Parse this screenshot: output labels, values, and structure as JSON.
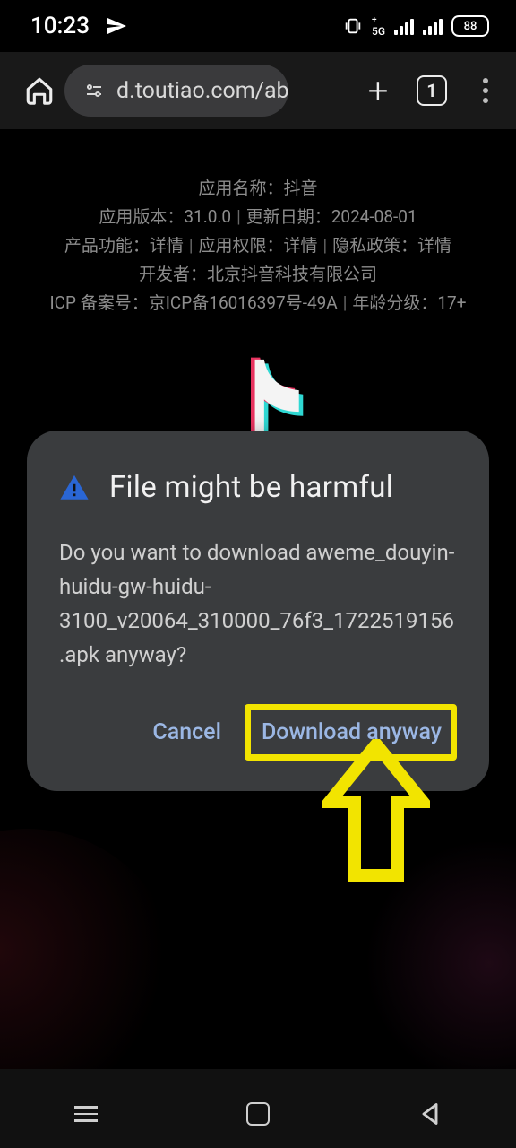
{
  "status_bar": {
    "time": "10:23",
    "network_label": "5G",
    "battery_text": "88"
  },
  "browser": {
    "url_display": "d.toutiao.com/ab.",
    "tab_count": "1"
  },
  "page_meta": {
    "line1": "应用名称：抖音",
    "line2_a": "应用版本：31.0.0",
    "line2_b": "更新日期：2024-08-01",
    "line3_a": "产品功能：详情",
    "line3_b": "应用权限：详情",
    "line3_c": "隐私政策：详情",
    "line4": "开发者：北京抖音科技有限公司",
    "line5_a": "ICP 备案号：京ICP备16016397号-49A",
    "line5_b": "年龄分级：17+"
  },
  "dialog": {
    "title": "File might be harmful",
    "body": "Do you want to download aweme_douyin-huidu-gw-huidu-3100_v20064_310000_76f3_1722519156.apk anyway?",
    "cancel_label": "Cancel",
    "download_label": "Download anyway"
  }
}
